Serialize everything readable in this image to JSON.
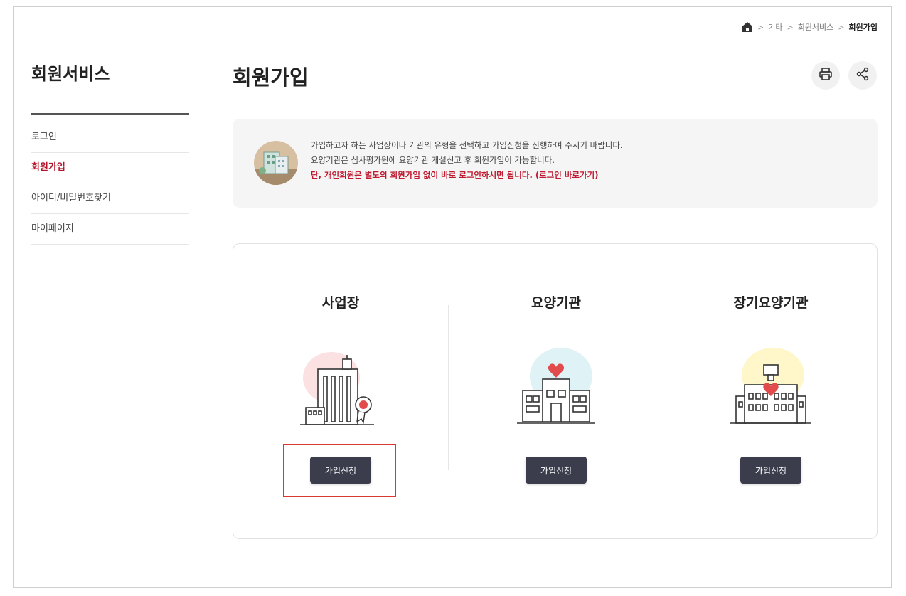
{
  "breadcrumb": {
    "items": [
      "기타",
      "회원서비스",
      "회원가입"
    ],
    "separator": ">"
  },
  "sidebar": {
    "title": "회원서비스",
    "items": [
      {
        "label": "로그인",
        "active": false
      },
      {
        "label": "회원가입",
        "active": true
      },
      {
        "label": "아이디/비밀번호찾기",
        "active": false
      },
      {
        "label": "마이페이지",
        "active": false
      }
    ]
  },
  "main": {
    "title": "회원가입",
    "tools": {
      "print_icon": "print-icon",
      "share_icon": "share-icon"
    }
  },
  "notice": {
    "icon": "building-icon",
    "line1": "가입하고자 하는 사업장이나 기관의 유형을 선택하고 가입신청을 진행하여 주시기 바랍니다.",
    "line2": "요양기관은 심사평가원에 요양기관 개설신고 후 회원가입이 가능합니다.",
    "line3_warn": "단, 개인회원은 별도의 회원가입 없이 바로 로그인하시면 됩니다. (",
    "line3_link": "로그인 바로가기",
    "line3_end": ")"
  },
  "cards": [
    {
      "title": "사업장",
      "icon": "office-building-icon",
      "button": "가입신청",
      "highlighted": true
    },
    {
      "title": "요양기관",
      "icon": "hospital-icon",
      "button": "가입신청",
      "highlighted": false
    },
    {
      "title": "장기요양기관",
      "icon": "care-facility-icon",
      "button": "가입신청",
      "highlighted": false
    }
  ],
  "colors": {
    "accent": "#c0182f",
    "button_bg": "#3b3d4c",
    "highlight_border": "#d93a2f"
  }
}
